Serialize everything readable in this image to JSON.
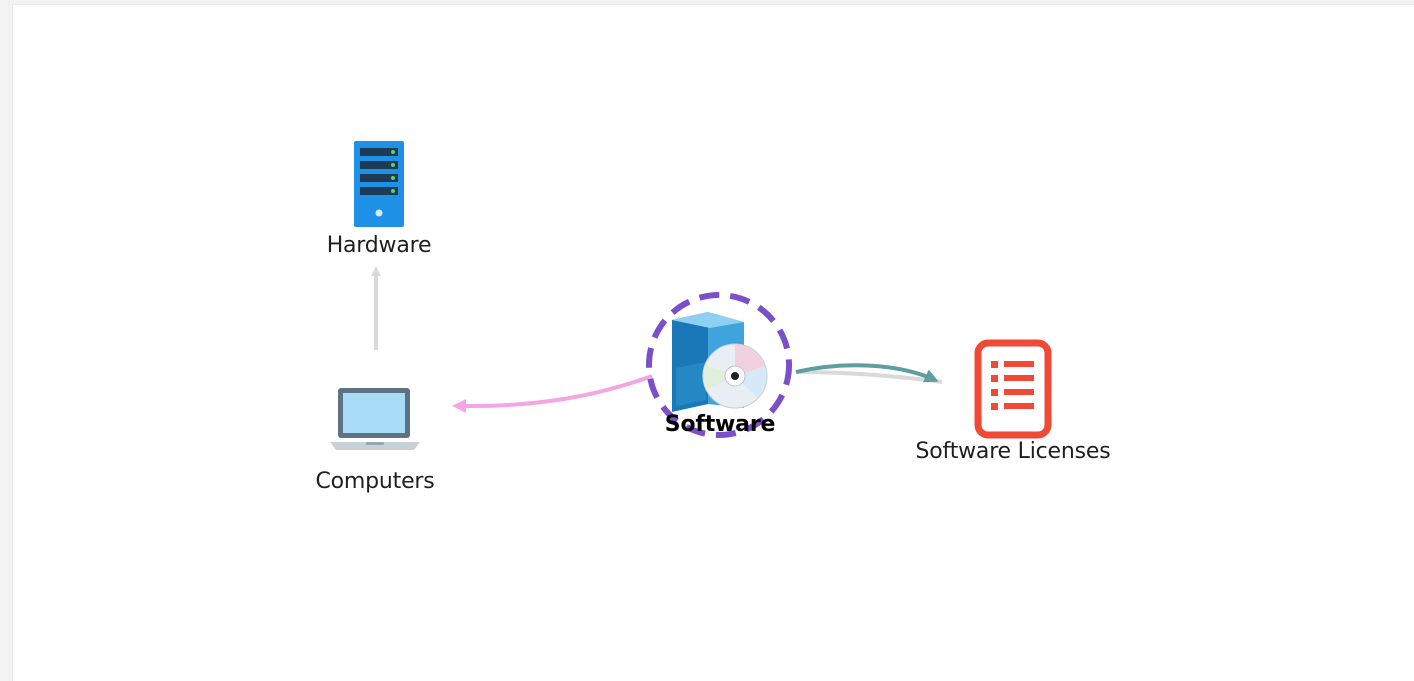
{
  "nodes": {
    "hardware": {
      "label": "Hardware",
      "icon": "server-icon"
    },
    "computers": {
      "label": "Computers",
      "icon": "laptop-icon"
    },
    "software": {
      "label": "Software",
      "icon": "software-box-icon",
      "selected": true
    },
    "licenses": {
      "label": "Software Licenses",
      "icon": "license-list-icon"
    }
  },
  "edges": [
    {
      "from": "computers",
      "to": "hardware",
      "color": "#d9d9d9"
    },
    {
      "from": "software",
      "to": "computers",
      "color": "#f4a6e4"
    },
    {
      "from": "software",
      "to": "licenses",
      "color": "#5f9ea0"
    },
    {
      "from": "licenses",
      "to": "software",
      "color": "#d9d9d9"
    }
  ],
  "colors": {
    "selection_ring": "#7b4fc9",
    "server_blue": "#1e90e6",
    "license_red": "#f04a36"
  }
}
